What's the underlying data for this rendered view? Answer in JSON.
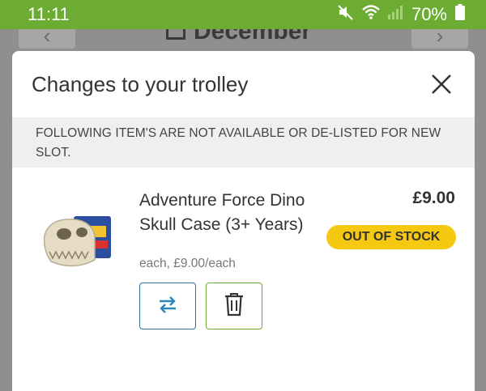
{
  "status_bar": {
    "time": "11:11",
    "battery": "70%",
    "icons": [
      "mute-icon",
      "wifi-icon",
      "signal-icon",
      "battery-icon"
    ]
  },
  "background": {
    "title": "December",
    "prev_icon": "chevron-left-icon",
    "next_icon": "chevron-right-icon",
    "calendar_icon": "calendar-icon"
  },
  "modal": {
    "title": "Changes to your trolley",
    "close_icon": "close-icon",
    "notice": "FOLLOWING ITEM'S ARE NOT AVAILABLE OR DE-LISTED FOR NEW SLOT.",
    "item": {
      "name": "Adventure Force Dino Skull Case (3+ Years)",
      "price": "£9.00",
      "badge": "OUT OF STOCK",
      "unit_price": "each, £9.00/each",
      "image_icon": "dino-skull-case-image",
      "swap_icon": "swap-arrows-icon",
      "delete_icon": "trash-icon"
    }
  },
  "colors": {
    "status_bar": "#6dac33",
    "badge": "#f5c911",
    "swap_border": "#2c6fa2",
    "delete_border": "#6dac33"
  }
}
